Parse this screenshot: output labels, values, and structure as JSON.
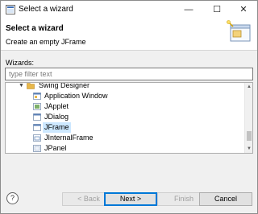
{
  "window": {
    "title": "Select a wizard",
    "controls": {
      "minimize": "—",
      "maximize": "☐",
      "close": "✕"
    }
  },
  "banner": {
    "title": "Select a wizard",
    "description": "Create an empty JFrame",
    "icon": "wizard-banner-icon"
  },
  "wizards": {
    "label": "Wizards:",
    "filter_placeholder": "type filter text",
    "filter_value": "",
    "tree": [
      {
        "label": "Swing Designer",
        "type": "folder",
        "expanded": true,
        "icon": "folder-icon"
      },
      {
        "label": "Application Window",
        "type": "leaf",
        "icon": "class-icon"
      },
      {
        "label": "JApplet",
        "type": "leaf",
        "icon": "class-icon"
      },
      {
        "label": "JDialog",
        "type": "leaf",
        "icon": "class-icon"
      },
      {
        "label": "JFrame",
        "type": "leaf",
        "icon": "class-icon",
        "selected": true
      },
      {
        "label": "JInternalFrame",
        "type": "leaf",
        "icon": "class-icon"
      },
      {
        "label": "JPanel",
        "type": "leaf",
        "icon": "class-icon"
      }
    ]
  },
  "footer": {
    "help": "?",
    "back": "< Back",
    "next": "Next >",
    "finish": "Finish",
    "cancel": "Cancel"
  },
  "colors": {
    "selection": "#cde8ff",
    "default_button_border": "#0078d7",
    "folder": "#e8b84a"
  }
}
